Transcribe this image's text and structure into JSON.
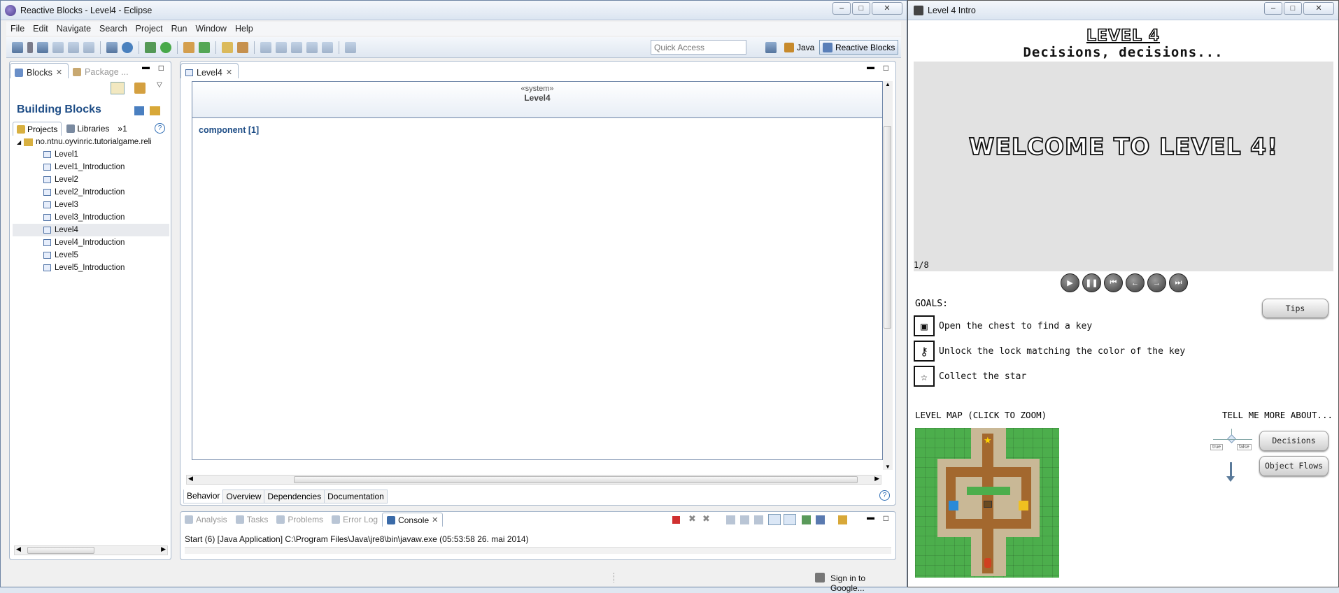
{
  "eclipse": {
    "title": "Reactive Blocks - Level4 - Eclipse",
    "menu": [
      "File",
      "Edit",
      "Navigate",
      "Search",
      "Project",
      "Run",
      "Window",
      "Help"
    ],
    "quick_access_placeholder": "Quick Access",
    "perspectives": [
      "Java",
      "Reactive Blocks"
    ],
    "left_panel": {
      "tabs": [
        "Blocks",
        "Package ..."
      ],
      "heading": "Building Blocks",
      "subtabs": [
        "Projects",
        "Libraries",
        "»1"
      ],
      "project": "no.ntnu.oyvinric.tutorialgame.reli",
      "items": [
        "Level1",
        "Level1_Introduction",
        "Level2",
        "Level2_Introduction",
        "Level3",
        "Level3_Introduction",
        "Level4",
        "Level4_Introduction",
        "Level5",
        "Level5_Introduction"
      ],
      "selected": "Level4"
    },
    "editor": {
      "tab": "Level4",
      "stereotype": "«system»",
      "name": "Level4",
      "component_label": "component [1]",
      "bottom_tabs": [
        "Behavior",
        "Overview",
        "Dependencies",
        "Documentation"
      ]
    },
    "console": {
      "tabs": [
        "Analysis",
        "Tasks",
        "Problems",
        "Error Log",
        "Console"
      ],
      "line": "Start (6) [Java Application] C:\\Program Files\\Java\\jre8\\bin\\javaw.exe (05:53:58 26. mai 2014)"
    },
    "status": "Sign in to Google..."
  },
  "game": {
    "title": "Level 4 Intro",
    "level_title": "LEVEL 4",
    "level_subtitle": "Decisions, decisions...",
    "welcome": "WELCOME TO LEVEL 4!",
    "page_counter": "1/8",
    "controls": [
      "play",
      "pause",
      "first",
      "prev",
      "next",
      "last"
    ],
    "goals_label": "GOALS:",
    "tips_button": "Tips",
    "goals": [
      {
        "icon": "chest-icon",
        "text": "Open the chest to find a key"
      },
      {
        "icon": "lock-icon",
        "text": "Unlock the lock matching the color of the key"
      },
      {
        "icon": "star-icon",
        "text": "Collect the star"
      }
    ],
    "map_label": "LEVEL MAP (CLICK TO ZOOM)",
    "tell_more_label": "TELL ME MORE ABOUT...",
    "decision_true": "true",
    "decision_false": "false",
    "more_buttons": [
      "Decisions",
      "Object Flows"
    ]
  }
}
